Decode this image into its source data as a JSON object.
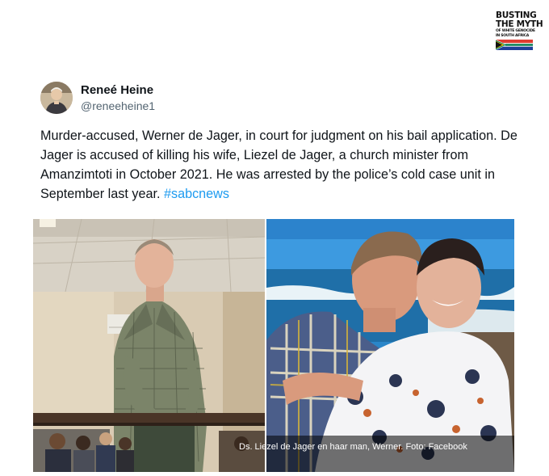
{
  "logo": {
    "line1": "BUSTING",
    "line2": "THE MYTH",
    "line3": "OF WHITE GENOCIDE",
    "line4": "IN SOUTH AFRICA",
    "flag_icon": "south-africa-flag-icon"
  },
  "tweet": {
    "author_name": "Reneé Heine",
    "author_handle": "@reneeheine1",
    "avatar_icon": "avatar-photo",
    "text": "Murder-accused, Werner de Jager, in court for judgment on his bail application. De Jager is accused of killing his wife, Liezel de Jager, a church minister from Amanzimtoti in October 2021. He was arrested by the police’s cold case unit in September last year. ",
    "hashtag": "#sabcnews",
    "hashtag_color": "#1d9bf0"
  },
  "media": {
    "left_photo": "courtroom-photo",
    "right_photo": "couple-beach-photo",
    "caption": "Ds. Liezel de Jager en haar man, Werner. Foto: Facebook"
  }
}
